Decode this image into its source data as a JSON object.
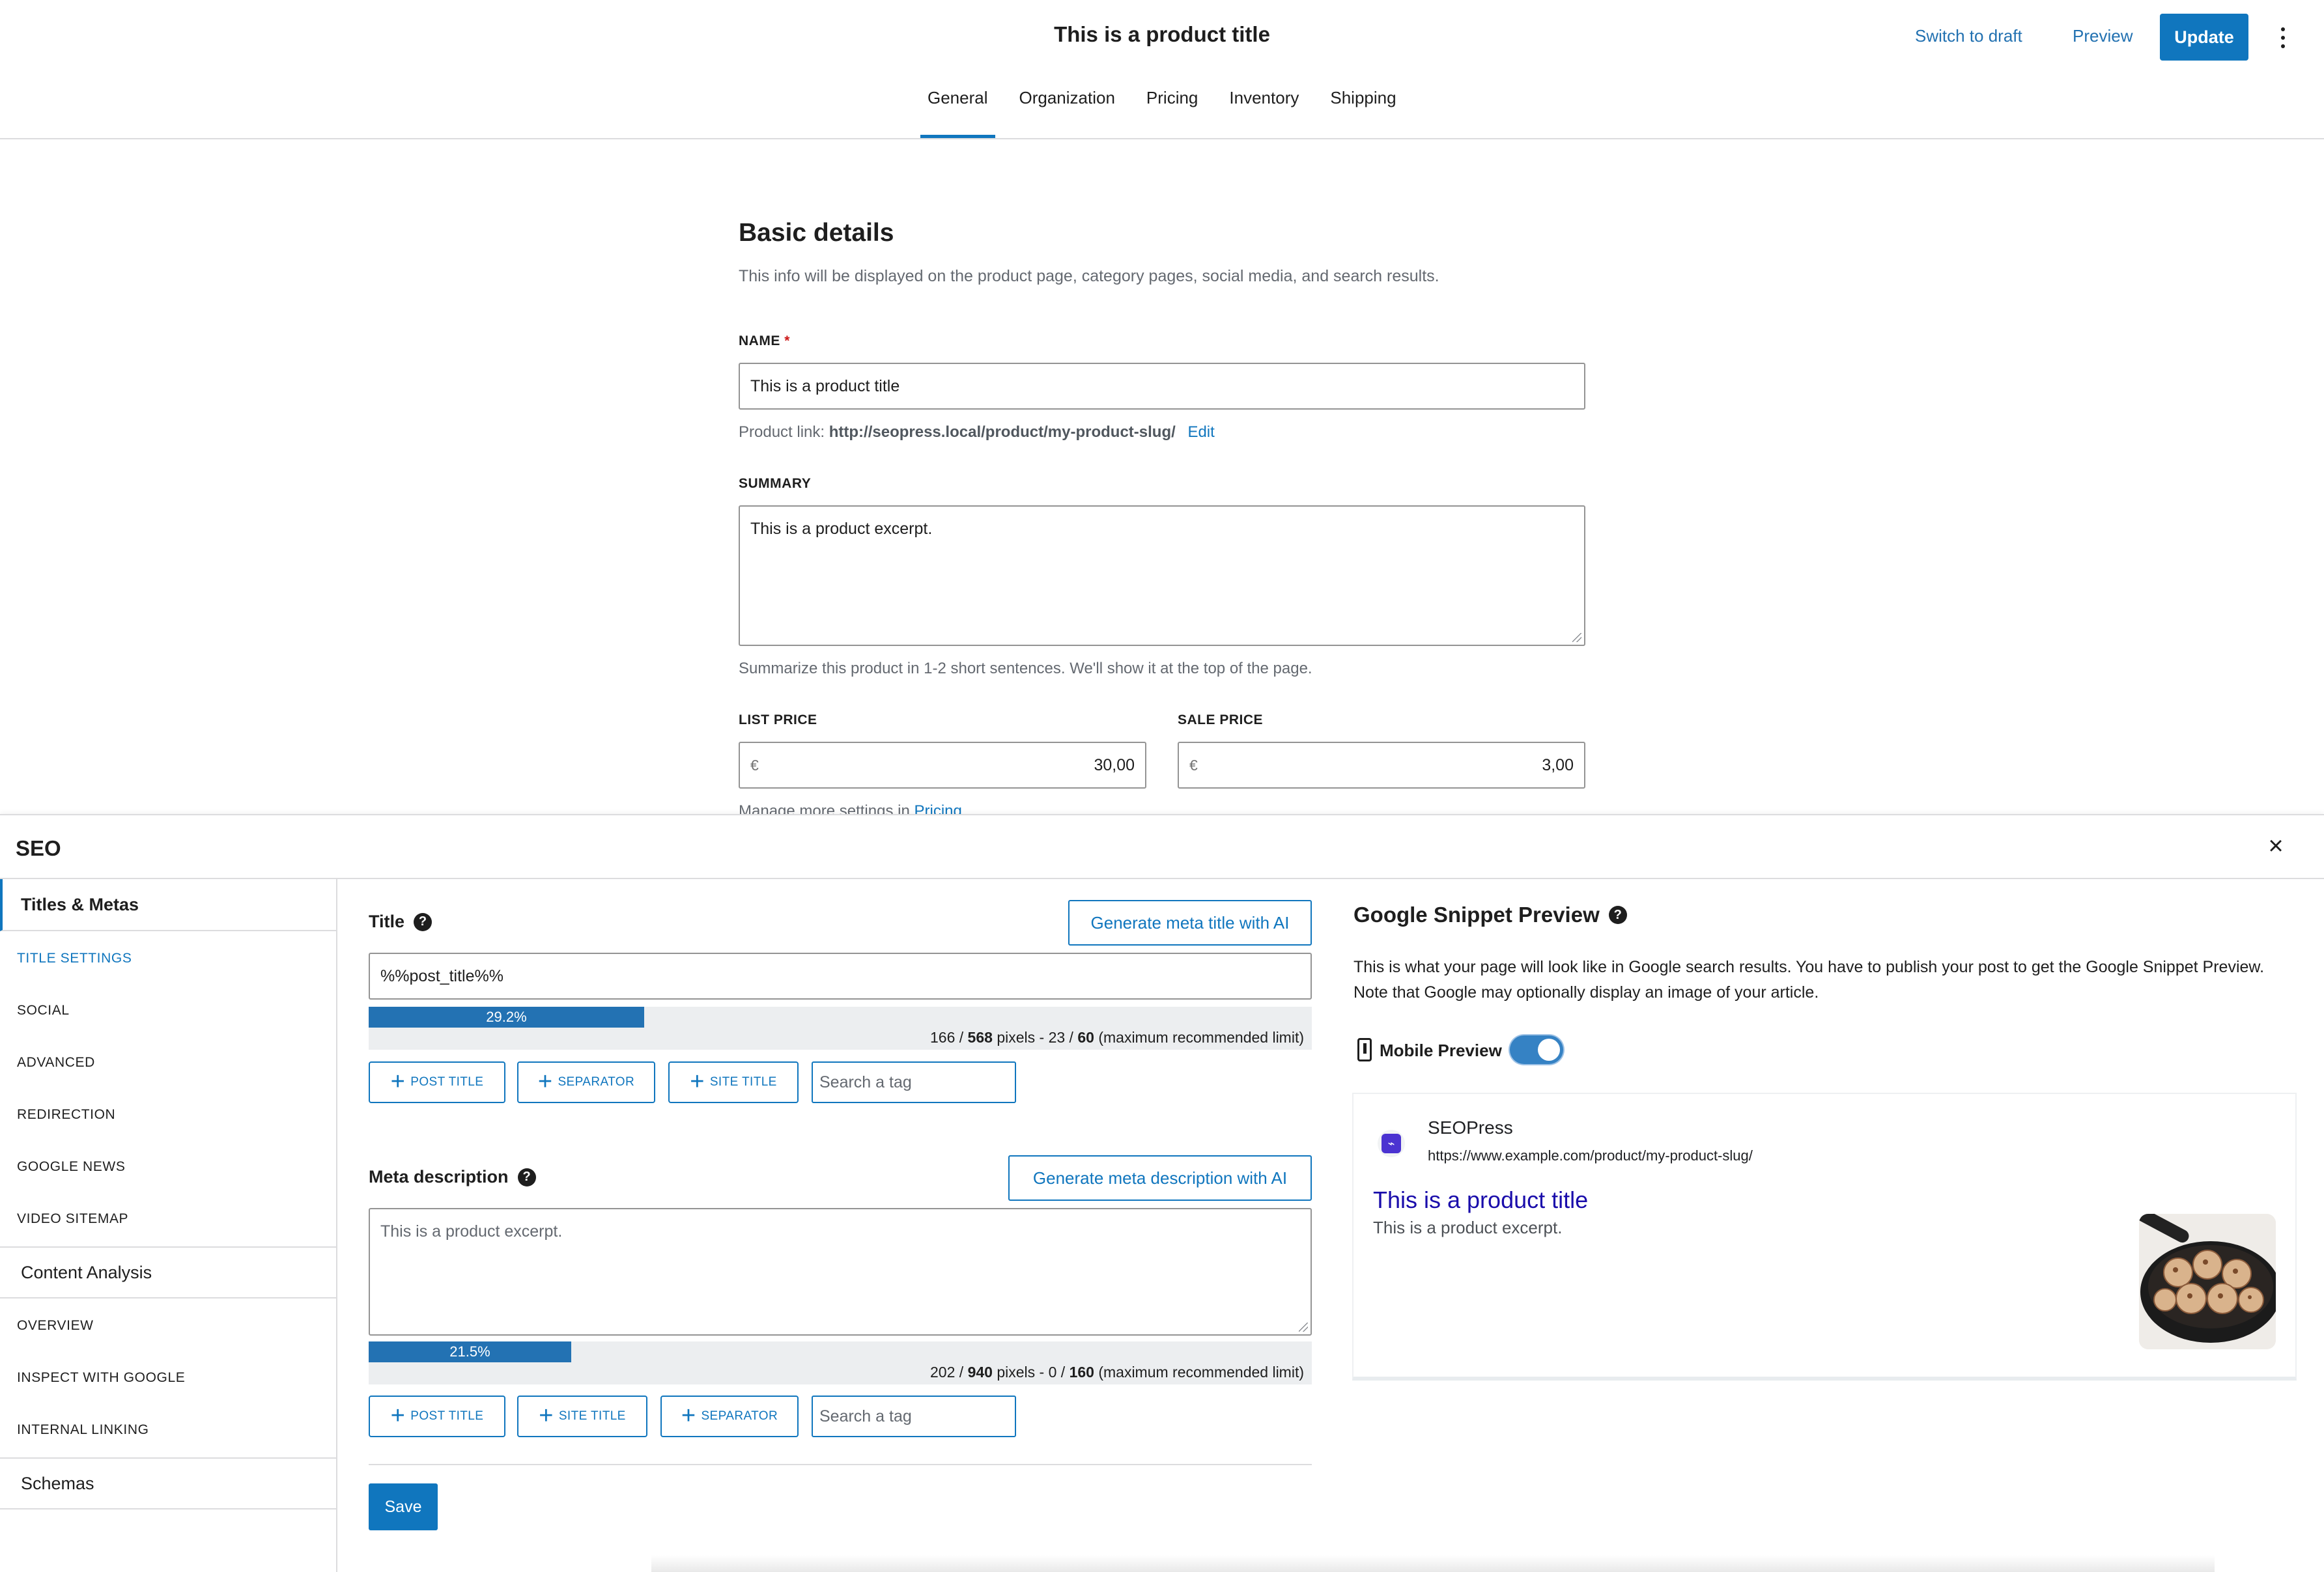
{
  "header": {
    "title": "This is a product title",
    "switch_to_draft": "Switch to draft",
    "preview": "Preview",
    "update": "Update",
    "tabs": [
      {
        "label": "General",
        "active": true
      },
      {
        "label": "Organization"
      },
      {
        "label": "Pricing"
      },
      {
        "label": "Inventory"
      },
      {
        "label": "Shipping"
      }
    ]
  },
  "basic": {
    "heading": "Basic details",
    "description": "This info will be displayed on the product page, category pages, social media, and search results.",
    "name_label": "NAME",
    "required_mark": "*",
    "name_value": "This is a product title",
    "product_link_prefix": "Product link:",
    "product_link_url": "http://seopress.local/product/my-product-slug/",
    "edit": "Edit",
    "summary_label": "SUMMARY",
    "summary_value": "This is a product excerpt.",
    "summary_help": "Summarize this product in 1-2 short sentences. We'll show it at the top of the page.",
    "list_price_label": "LIST PRICE",
    "list_price_currency": "€",
    "list_price_value": "30,00",
    "sale_price_label": "SALE PRICE",
    "sale_price_currency": "€",
    "sale_price_value": "3,00",
    "manage_more_prefix": "Manage more settings in",
    "manage_more_link": "Pricing"
  },
  "seo": {
    "heading": "SEO",
    "close_icon": "close-icon",
    "sidebar": {
      "group1": "Titles & Metas",
      "group1_items": [
        "TITLE SETTINGS",
        "SOCIAL",
        "ADVANCED",
        "REDIRECTION",
        "GOOGLE NEWS",
        "VIDEO SITEMAP"
      ],
      "group2": "Content Analysis",
      "group2_items": [
        "OVERVIEW",
        "INSPECT WITH GOOGLE",
        "INTERNAL LINKING"
      ],
      "group3": "Schemas"
    },
    "title_field": {
      "label": "Title",
      "ai_button": "Generate meta title with AI",
      "value": "%%post_title%%",
      "meter_percent": "29.2%",
      "meter_fraction": 0.292,
      "px_used": "166",
      "px_max": "568",
      "chars_used": "23",
      "chars_max": "60",
      "tags": [
        "POST TITLE",
        "SEPARATOR",
        "SITE TITLE"
      ],
      "search_placeholder": "Search a tag"
    },
    "meta_field": {
      "label": "Meta description",
      "ai_button": "Generate meta description with AI",
      "value": "This is a product excerpt.",
      "meter_percent": "21.5%",
      "meter_fraction": 0.215,
      "px_used": "202",
      "px_max": "940",
      "chars_used": "0",
      "chars_max": "160",
      "tags": [
        "POST TITLE",
        "SITE TITLE",
        "SEPARATOR"
      ],
      "search_placeholder": "Search a tag"
    },
    "pixels_word": "pixels",
    "limit_note": "(maximum recommended limit)",
    "save": "Save",
    "snippet": {
      "heading": "Google Snippet Preview",
      "description": "This is what your page will look like in Google search results. You have to publish your post to get the Google Snippet Preview. Note that Google may optionally display an image of your article.",
      "mobile_preview_label": "Mobile Preview",
      "mobile_preview_on": true,
      "site_name": "SEOPress",
      "url": "https://www.example.com/product/my-product-slug/",
      "result_title": "This is a product title",
      "result_description": "This is a product excerpt."
    }
  },
  "colors": {
    "accent": "#1076be",
    "meter_fill": "#2372b3",
    "link": "#2271b1",
    "serp_title": "#1a0dab"
  }
}
